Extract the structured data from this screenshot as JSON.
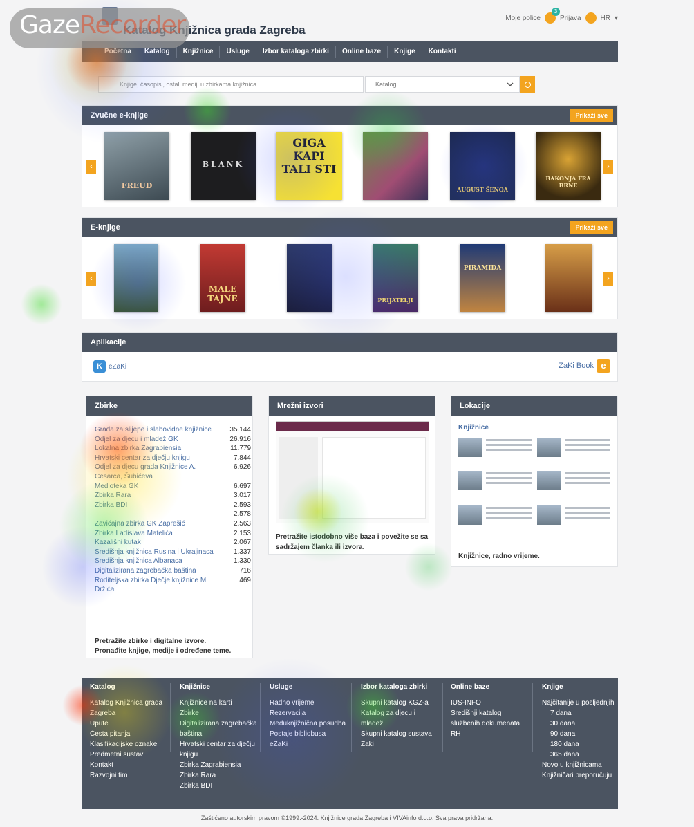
{
  "header": {
    "site_title": "Katalog Knjižnica grada Zagreba",
    "my_shelves": "Moje police",
    "shelves_badge": "3",
    "login": "Prijava",
    "language": "HR"
  },
  "nav": {
    "items": [
      "Početna",
      "Katalog",
      "Knjižnice",
      "Usluge",
      "Izbor kataloga zbirki",
      "Online baze",
      "Knjige",
      "Kontakti"
    ]
  },
  "search": {
    "placeholder": "Knjige, časopisi, ostali mediji u zbirkama knjižnica",
    "scope": "Katalog"
  },
  "audiobooks": {
    "title": "Zvučne e-knjige",
    "show_all": "Prikaži sve",
    "covers": [
      {
        "text": "FREUD"
      },
      {
        "text": "BLANK"
      },
      {
        "text": "GIGA KAPI TALI STI"
      },
      {
        "text": ""
      },
      {
        "text": "AUGUST ŠENOA"
      },
      {
        "text": "BAKONJA FRA BRNE"
      }
    ]
  },
  "ebooks": {
    "title": "E-knjige",
    "show_all": "Prikaži sve",
    "covers": [
      {
        "text": ""
      },
      {
        "text": "MALE TAJNE"
      },
      {
        "text": ""
      },
      {
        "text": "PRIJATELJI"
      },
      {
        "text": "PIRAMIDA"
      },
      {
        "text": ""
      }
    ]
  },
  "apps": {
    "title": "Aplikacije",
    "left_app": "eZaKi",
    "right_app": "ZaKi Book"
  },
  "collections": {
    "title": "Zbirke",
    "rows": [
      {
        "name": "Građa za slijepe i slabovidne knjižnice",
        "count": "35.144"
      },
      {
        "name": "Odjel za djecu i mladež GK",
        "count": "26.916"
      },
      {
        "name": "Lokalna zbirka Zagrabiensia",
        "count": "11.779"
      },
      {
        "name": "Hrvatski centar za dječju knjigu",
        "count": "7.844"
      },
      {
        "name": "Odjel za djecu grada Knjižnice A. Cesarca, Šubićeva",
        "count": "6.926"
      },
      {
        "name": "Medioteka GK",
        "count": "6.697"
      },
      {
        "name": "Zbirka Rara",
        "count": "3.017"
      },
      {
        "name": "Zbirka BDI",
        "count": "2.593"
      },
      {
        "name": "",
        "count": "2.578"
      },
      {
        "name": "Zavičajna zbirka GK Zaprešić",
        "count": "2.563"
      },
      {
        "name": "Zbirka Ladislava Matelića",
        "count": "2.153"
      },
      {
        "name": "Kazališni kutak",
        "count": "2.067"
      },
      {
        "name": "Središnja knjižnica Rusina i Ukrajinaca",
        "count": "1.337"
      },
      {
        "name": "Središnja knjižnica Albanaca",
        "count": "1.330"
      },
      {
        "name": "Digitalizirana zagrebačka baština",
        "count": "716"
      },
      {
        "name": "Roditeljska zbirka Dječje knjižnice M. Držića",
        "count": "469"
      }
    ],
    "footer_line1": "Pretražite zbirke i digitalne izvore.",
    "footer_line2": "Pronađite knjige, medije i određene teme."
  },
  "web_sources": {
    "title": "Mrežni izvori",
    "description": "Pretražite istodobno više baza i povežite se sa sadržajem članka ili izvora."
  },
  "locations": {
    "title": "Lokacije",
    "subtitle": "Knjižnice",
    "footer": "Knjižnice, radno vrijeme."
  },
  "footer": {
    "columns": [
      {
        "title": "Katalog",
        "links": [
          "Katalog Knjižnica grada Zagreba",
          "Upute",
          "Česta pitanja",
          "Klasifikacijske oznake",
          "Predmetni sustav",
          "Kontakt",
          "Razvojni tim"
        ]
      },
      {
        "title": "Knjižnice",
        "links": [
          "Knjižnice na karti",
          "Zbirke",
          "Digitalizirana zagrebačka baština",
          "Hrvatski centar za dječju knjigu",
          "Zbirka Zagrabiensia",
          "Zbirka Rara",
          "Zbirka BDI"
        ]
      },
      {
        "title": "Usluge",
        "links": [
          "Radno vrijeme",
          "Rezervacija",
          "Međuknjižnična posudba",
          "Postaje bibliobusa",
          "eZaKi"
        ]
      },
      {
        "title": "Izbor kataloga zbirki",
        "links": [
          "Skupni katalog KGZ-a",
          "Katalog za djecu i mladež",
          "Skupni katalog sustava Zaki"
        ]
      },
      {
        "title": "Online baze",
        "links": [
          "IUS-INFO",
          "Središnji katalog službenih dokumenata RH"
        ]
      },
      {
        "title": "Knjige",
        "links": [
          "Najčitanije u posljednjih",
          "7 dana",
          "30 dana",
          "90 dana",
          "180 dana",
          "365 dana",
          "Novo u knjižnicama",
          "Knjižničari preporučuju"
        ]
      }
    ],
    "copyright": "Zaštićeno autorskim pravom ©1999.-2024. Knjižnice grada Zagreba i VIVAinfo d.o.o. Sva prava pridržana."
  },
  "overlay": {
    "brand_prefix": "Gaze",
    "brand_suffix": "Recorder"
  },
  "colors": {
    "accent": "#f3a41f",
    "nav_bg": "#4b5461",
    "link": "#4a6fa5"
  }
}
